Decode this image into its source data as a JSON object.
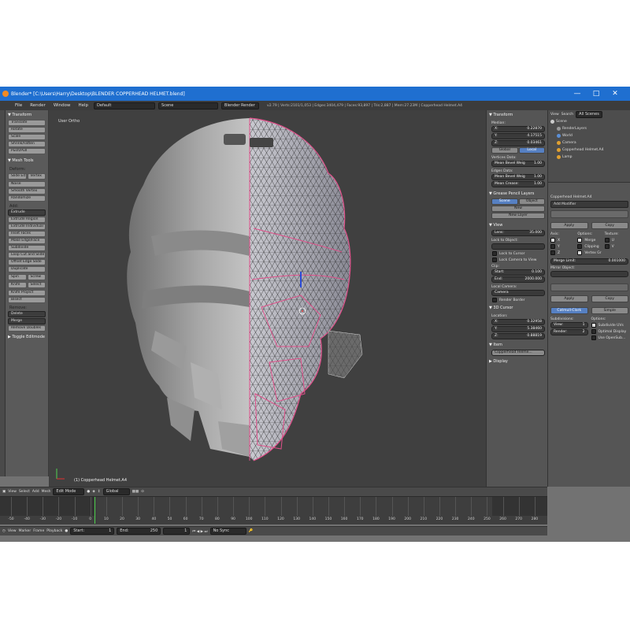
{
  "window": {
    "title": "Blender* [C:\\Users\\Harry\\Desktop\\BLENDER COPPERHEAD HELMET.blend]",
    "minimize": "—",
    "maximize": "□",
    "close": "✕"
  },
  "infobar": {
    "menus": [
      "File",
      "Render",
      "Window",
      "Help"
    ],
    "layout": "Default",
    "scene": "Scene",
    "engine": "Blender Render",
    "stats": "v2.79 | Verts:2101/1,053 | Edges:3404,479 | Faces:93,897 | Tris:2,887 | Mem:27.23M | Copperhead Helmet.A4"
  },
  "toolshelf": {
    "transform_header": "▼ Transform",
    "transform": [
      "Translate",
      "Rotate",
      "Scale",
      "Shrink/Fatten",
      "Push/Pull"
    ],
    "meshtools_header": "▼ Mesh Tools",
    "deform_label": "Deform:",
    "deform_row": [
      "Slide Ed",
      "Vertex"
    ],
    "deform": [
      "Noise",
      "Smooth Vertex",
      "Randomize"
    ],
    "add_label": "Add:",
    "add_dropdown": "Extrude",
    "add": [
      "Extrude Region",
      "Extrude Individual",
      "Inset Faces",
      "Make Edge/Face",
      "Subdivide",
      "Loop Cut and Slide",
      "Offset Edge Slide",
      "Duplicate"
    ],
    "spin_row": [
      "Spin",
      "Screw"
    ],
    "knife_row": [
      "Knife",
      "Select"
    ],
    "add_more": [
      "Knife Project",
      "Bisect"
    ],
    "remove_label": "Remove:",
    "remove_dropdowns": [
      "Delete",
      "Merge"
    ],
    "remove_doubles": "Remove Doubles",
    "toggle": "▶ Toggle Editmode"
  },
  "viewport": {
    "label": "User Ortho",
    "object": "(1) Copperhead Helmet.A4"
  },
  "npanel": {
    "transform": "▼ Transform",
    "median": "Median:",
    "x": [
      "X:",
      "0.22870"
    ],
    "y": [
      "Y:",
      "4.17515"
    ],
    "z": [
      "Z:",
      "0.03461"
    ],
    "global": "Global",
    "local": "Local",
    "mean_weight": "Vertices Data:",
    "bevel_weight": [
      "Mean Bevel Weig",
      "1.00"
    ],
    "edges_data": "Edges Data:",
    "edge_bevel": [
      "Mean Bevel Weig",
      "1.00"
    ],
    "crease": [
      "Mean Crease:",
      "1.00"
    ],
    "grease_header": "▼ Grease Pencil Layers",
    "scene_btn": "Scene",
    "object_btn": "Object",
    "new": "New",
    "new_layer": "New Layer",
    "view_header": "▼ View",
    "lens": [
      "Lens:",
      "35.000"
    ],
    "lock_obj": "Lock to Object:",
    "lock_cursor": "Lock to Cursor",
    "lock_cam": "Lock Camera to View",
    "clip": "Clip:",
    "clip_start": [
      "Start:",
      "0.100"
    ],
    "clip_end": [
      "End:",
      "2000.000"
    ],
    "local_camera": "Local Camera:",
    "camera": "Camera",
    "render_border": "Render Border",
    "cursor_header": "▼ 3D Cursor",
    "location": "Location:",
    "cx": [
      "X:",
      "0.32958"
    ],
    "cy": [
      "Y:",
      "5.38460"
    ],
    "cz": [
      "Z:",
      "0.88819"
    ],
    "item_header": "▼ Item",
    "item_name": "Copperhead Helme...",
    "display": "▶ Display"
  },
  "outliner": {
    "tabs": [
      "View",
      "Search",
      "All Scenes"
    ],
    "items": [
      "Scene",
      "RenderLayers",
      "World",
      "Camera",
      "Copperhead Helmet.A4",
      "Lamp"
    ]
  },
  "properties": {
    "object_name": "Copperhead Helmet.A4",
    "add_modifier": "Add Modifier",
    "apply": "Apply",
    "copy": "Copy",
    "axis": "Axis:",
    "options": "Options:",
    "texture": "Texture:",
    "ax": [
      "X",
      "Y",
      "Z"
    ],
    "opts": [
      "Merge",
      "Clipping",
      "Vertex Gr"
    ],
    "tex": [
      "U",
      "V"
    ],
    "merge_limit": [
      "Merge Limit:",
      "0.001000"
    ],
    "mirror_object": "Mirror Object:",
    "apply2": "Apply",
    "copy2": "Copy",
    "catmull": "Catmull-Clark",
    "simple": "Simple",
    "subdivisions": "Subdivisions:",
    "view": [
      "View:",
      "1"
    ],
    "render": [
      "Render:",
      "2"
    ],
    "options2": "Options:",
    "subdiv_uvs": "Subdivide UVs",
    "optimal": "Optimal Display",
    "opensubdiv": "Use OpenSub..."
  },
  "header3d": {
    "items": [
      "View",
      "Select",
      "Add",
      "Mesh"
    ],
    "mode": "Edit Mode",
    "orientation": "Global"
  },
  "timeline": {
    "ticks": [
      "-50",
      "-40",
      "-30",
      "-20",
      "-10",
      "0",
      "10",
      "20",
      "30",
      "40",
      "50",
      "60",
      "70",
      "80",
      "90",
      "100",
      "110",
      "120",
      "130",
      "140",
      "150",
      "160",
      "170",
      "180",
      "190",
      "200",
      "210",
      "220",
      "230",
      "240",
      "250",
      "260",
      "270",
      "280"
    ],
    "menus": [
      "View",
      "Marker",
      "Frame",
      "Playback"
    ],
    "start": "Start:",
    "start_val": "1",
    "end": "End:",
    "end_val": "250",
    "current": "1",
    "sync": "No Sync"
  }
}
